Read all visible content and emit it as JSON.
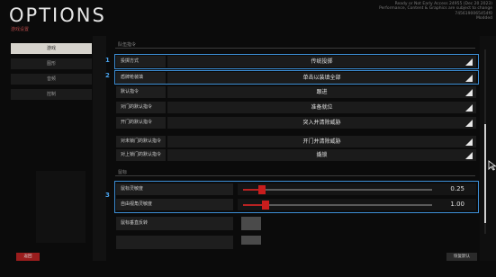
{
  "header": {
    "title": "OPTIONS",
    "subtitle": "游戏设置",
    "build_lines": [
      "Ready or Not Early Access 24955 (Dec 20 2023)",
      "Performance, Content & Graphics are subject to change",
      "7456190065454f0",
      "Modded"
    ]
  },
  "sidebar": {
    "tabs": [
      {
        "label": "游戏",
        "active": true
      },
      {
        "label": "图形",
        "active": false
      },
      {
        "label": "音频",
        "active": false
      },
      {
        "label": "控制",
        "active": false
      }
    ]
  },
  "sections": {
    "commands_title": "队伍指令",
    "mouse_title": "鼠标"
  },
  "command_rows": [
    {
      "label": "投掷方式",
      "value": "传统投掷"
    },
    {
      "label": "盾牌枪装填",
      "value": "单击以装填全部"
    },
    {
      "label": "默认指令",
      "value": "跟进"
    },
    {
      "label": "对门的默认指令",
      "value": "准备就位"
    },
    {
      "label": "开门的默认指令",
      "value": "突入并清除威胁"
    },
    {
      "label": "对未锁门的默认指令",
      "value": "开门并清除威胁"
    },
    {
      "label": "对上锁门的默认指令",
      "value": "撬锁"
    }
  ],
  "mouse_rows": [
    {
      "label": "鼠标灵敏度",
      "value": "0.25",
      "level": 0.1
    },
    {
      "label": "自由视角灵敏度",
      "value": "1.00",
      "level": 0.12
    }
  ],
  "toggle_rows": [
    {
      "label": "鼠标垂直反转"
    },
    {
      "label": ""
    }
  ],
  "callouts": [
    "1",
    "2",
    "3"
  ],
  "footer": {
    "back_label": "返回",
    "reset_label": "恢复默认"
  },
  "colors": {
    "accent": "#3d8fd6",
    "slider": "#c81d1d",
    "back": "#9a1d1d"
  },
  "icons": {
    "dropdown": "triangle-icon",
    "cursor": "cursor-icon"
  }
}
